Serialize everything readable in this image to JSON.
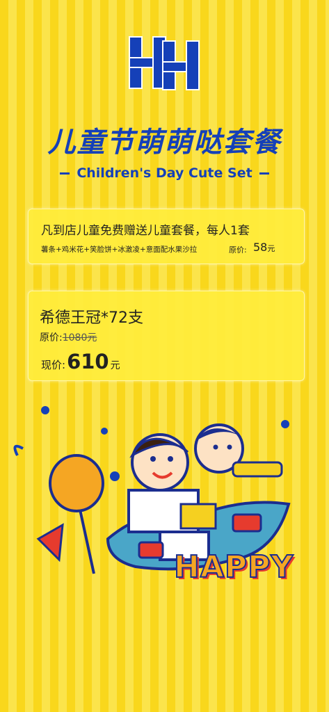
{
  "header": {
    "logo_icon": "hh-monogram-logo",
    "title": "儿童节萌萌哒套餐",
    "subtitle": "Children's Day Cute Set"
  },
  "offer_card": {
    "headline": "凡到店儿童免费赠送儿童套餐，每人1套",
    "items": "薯条+鸡米花+笑脸饼+冰激凌+意面配水果沙拉",
    "price_label": "原价:",
    "price_value": "58",
    "price_unit": "元"
  },
  "product_card": {
    "name": "希德王冠*72支",
    "original_label": "原价:",
    "original_value": "1080元",
    "current_label": "现价:",
    "current_value": "610",
    "current_unit": "元"
  },
  "illustration": {
    "icon": "kids-playing-cartoon",
    "banner_text": "HAPPY"
  },
  "colors": {
    "background": "#f9d71c",
    "accent_blue": "#1540b8",
    "card": "#ffec3c"
  }
}
